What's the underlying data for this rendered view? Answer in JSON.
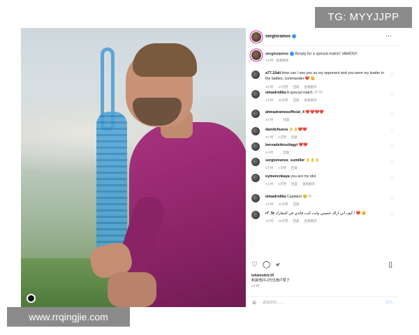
{
  "watermark_top": "TG: MYYJJPP",
  "watermark_bottom": "www.rrqingjie.com",
  "post": {
    "username": "sergioramos",
    "more_icon": "⋯",
    "caption_user": "sergioramos",
    "caption_text": "Ready for a special match! VAMOS!!",
    "caption_time": "3小时",
    "caption_translate": "查看翻译"
  },
  "comments": [
    {
      "user": "a77.10ali",
      "text": "How can I see you as my opponent and you were my leader in the battles, commander ❤️ 🫡",
      "time": "3小时",
      "likes": "17次赞",
      "reply": "回复",
      "translate": "查看翻译"
    },
    {
      "user": "elmadridiila",
      "text": "A special match 🤍🤍",
      "time": "3小时",
      "likes": "40次赞",
      "reply": "回复",
      "translate": "查看翻译"
    },
    {
      "user": "ahmadramosofficial_4",
      "text": "❤️❤️❤️❤️",
      "time": "3小时",
      "likes": "",
      "reply": "回复",
      "translate": ""
    },
    {
      "user": "davidchueca",
      "text": "👌👌❤️❤️",
      "time": "3小时",
      "likes": "1次赞",
      "reply": "回复",
      "translate": ""
    },
    {
      "user": "bernadetteszilagyi",
      "text": "❤️❤️",
      "time": "3小时",
      "likes": "",
      "reply": "回复",
      "translate": ""
    },
    {
      "user": "sergiomunoz_sumiller",
      "text": "👌👌👌",
      "time": "3小时",
      "likes": "1次赞",
      "reply": "回复",
      "translate": ""
    },
    {
      "user": "eymencnkaya",
      "text": "you are my idol",
      "time": "3小时",
      "likes": "2次赞",
      "reply": "回复",
      "translate": "查看翻译"
    },
    {
      "user": "elmadridiila",
      "text": "Capitano 😊🤍",
      "time": "3小时",
      "likes": "10次赞",
      "reply": "回复",
      "translate": ""
    },
    {
      "user": "r7_5r",
      "text": "كيف اني اراك خصمي وانت كنت قائدي في المعارك ! ❤️ 🫡",
      "time": "3小时",
      "likes": "16次赞",
      "reply": "回复",
      "translate": "查看翻译"
    }
  ],
  "likes_user": "lukamodric10",
  "likes_text": "和其他23.2万位用户赞了",
  "post_time": "3小时",
  "add_comment_placeholder": "添加评论……",
  "post_button": "发布",
  "icons": {
    "heart": "♡",
    "comment": "◯",
    "share": "➢",
    "save": "▯",
    "emoji": "☺"
  }
}
